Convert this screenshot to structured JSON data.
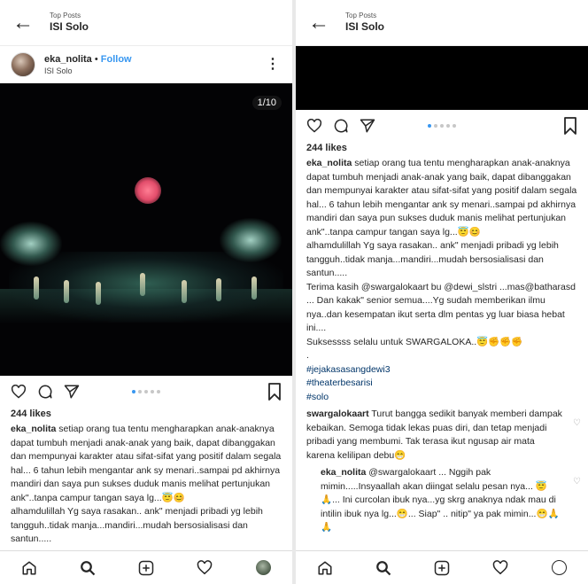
{
  "left": {
    "header": {
      "back_glyph": "←",
      "subtitle": "Top Posts",
      "title": "ISI Solo"
    },
    "post": {
      "author": "eka_nolita",
      "separator": " • ",
      "follow": "Follow",
      "location": "ISI Solo",
      "more_glyph": "⋮",
      "counter": "1/10"
    },
    "likes": "244 likes",
    "caption": {
      "username": "eka_nolita",
      "text1": " setiap orang tua tentu mengharapkan anak-anaknya dapat tumbuh menjadi anak-anak yang baik, dapat dibanggakan dan mempunyai karakter atau sifat-sifat yang positif dalam segala hal... 6 tahun lebih mengantar ank sy menari..sampai pd akhirnya mandiri dan saya pun sukses duduk manis melihat pertunjukan ank\"..tanpa campur tangan saya lg...😇😊",
      "text2": "alhamdulillah Yg saya rasakan.. ank\" menjadi pribadi yg lebih tangguh..tidak manja...mandiri...mudah bersosialisasi dan santun....."
    }
  },
  "right": {
    "header": {
      "back_glyph": "←",
      "subtitle": "Top Posts",
      "title": "ISI Solo"
    },
    "likes": "244 likes",
    "caption": {
      "username": "eka_nolita",
      "text1": " setiap orang tua tentu mengharapkan anak-anaknya dapat tumbuh menjadi anak-anak yang baik, dapat dibanggakan dan mempunyai karakter atau sifat-sifat yang positif dalam segala hal... 6 tahun lebih mengantar ank sy menari..sampai pd akhirnya mandiri dan saya pun sukses duduk manis melihat pertunjukan ank\"..tanpa campur tangan saya lg...😇😊",
      "text2": "alhamdulillah Yg saya rasakan.. ank\" menjadi pribadi yg lebih tangguh..tidak manja...mandiri...mudah bersosialisasi dan santun.....",
      "text3": "Terima kasih @swargalokaart  bu @dewi_slstri ...mas@batharasd ... Dan kakak\" senior semua....Yg sudah memberikan ilmu nya..dan kesempatan ikut serta dlm pentas yg luar biasa hebat ini....",
      "text4": "Suksessss selalu untuk SWARGALOKA..😇✊✊✊",
      "dot_line": "."
    },
    "hashtags": [
      "#jejakasasangdewi3",
      "#theaterbesarisi",
      "#solo"
    ],
    "comments": [
      {
        "username": "swargalokaart",
        "text": " Turut bangga sedikit banyak memberi dampak kebaikan. Semoga tidak lekas puas diri, dan tetap menjadi pribadi yang membumi. Tak terasa ikut ngusap air mata karena kelilipan debu😁"
      },
      {
        "username": "eka_nolita",
        "text": " @swargalokaart ... Nggih pak mimin.....Insyaallah akan diingat selalu pesan nya... 😇🙏... Ini curcolan ibuk nya...yg skrg anaknya ndak mau di intilin ibuk nya lg...😁... Siap\" .. nitip\" ya pak mimin...😁🙏🙏"
      }
    ],
    "comment_heart_glyph": "♡"
  },
  "colors": {
    "link": "#3897f0",
    "hashtag": "#003569",
    "text": "#262626",
    "dot_inactive": "#c7c7c7"
  }
}
